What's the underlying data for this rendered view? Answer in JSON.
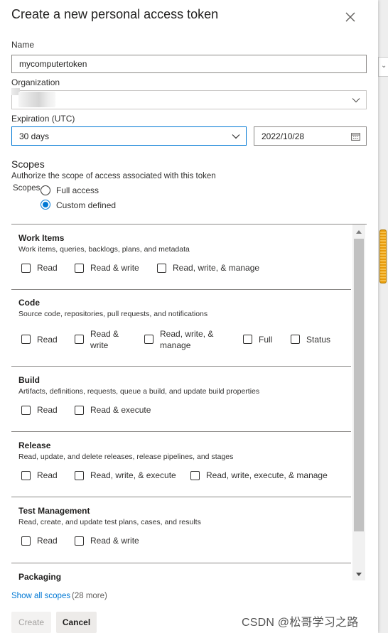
{
  "dialog": {
    "title": "Create a new personal access token"
  },
  "form": {
    "name_label": "Name",
    "name_value": "mycomputertoken",
    "organization_label": "Organization",
    "organization_value": "",
    "expiration_label": "Expiration (UTC)",
    "expiration_value": "30 days",
    "expiration_date": "2022/10/28"
  },
  "scopes": {
    "heading": "Scopes",
    "description": "Authorize the scope of access associated with this token",
    "label": "Scopes",
    "options": [
      {
        "label": "Full access",
        "selected": false
      },
      {
        "label": "Custom defined",
        "selected": true
      }
    ],
    "sections": [
      {
        "title": "Work Items",
        "description": "Work items, queries, backlogs, plans, and metadata",
        "options": [
          "Read",
          "Read & write",
          "Read, write, & manage"
        ]
      },
      {
        "title": "Code",
        "description": "Source code, repositories, pull requests, and notifications",
        "options": [
          "Read",
          "Read &\nwrite",
          "Read, write, &\nmanage",
          "Full",
          "Status"
        ]
      },
      {
        "title": "Build",
        "description": "Artifacts, definitions, requests, queue a build, and update build properties",
        "options": [
          "Read",
          "Read & execute"
        ]
      },
      {
        "title": "Release",
        "description": "Read, update, and delete releases, release pipelines, and stages",
        "options": [
          "Read",
          "Read, write, & execute",
          "Read, write, execute, & manage"
        ]
      },
      {
        "title": "Test Management",
        "description": "Read, create, and update test plans, cases, and results",
        "options": [
          "Read",
          "Read & write"
        ]
      },
      {
        "title": "Packaging",
        "description": "",
        "options": []
      }
    ],
    "show_all_link": "Show all scopes",
    "show_all_count": "(28 more)"
  },
  "actions": {
    "create_label": "Create",
    "cancel_label": "Cancel"
  },
  "watermark": "CSDN @松哥学习之路",
  "colors": {
    "accent": "#0078d4",
    "border": "#8a8886",
    "text": "#201f1e"
  }
}
